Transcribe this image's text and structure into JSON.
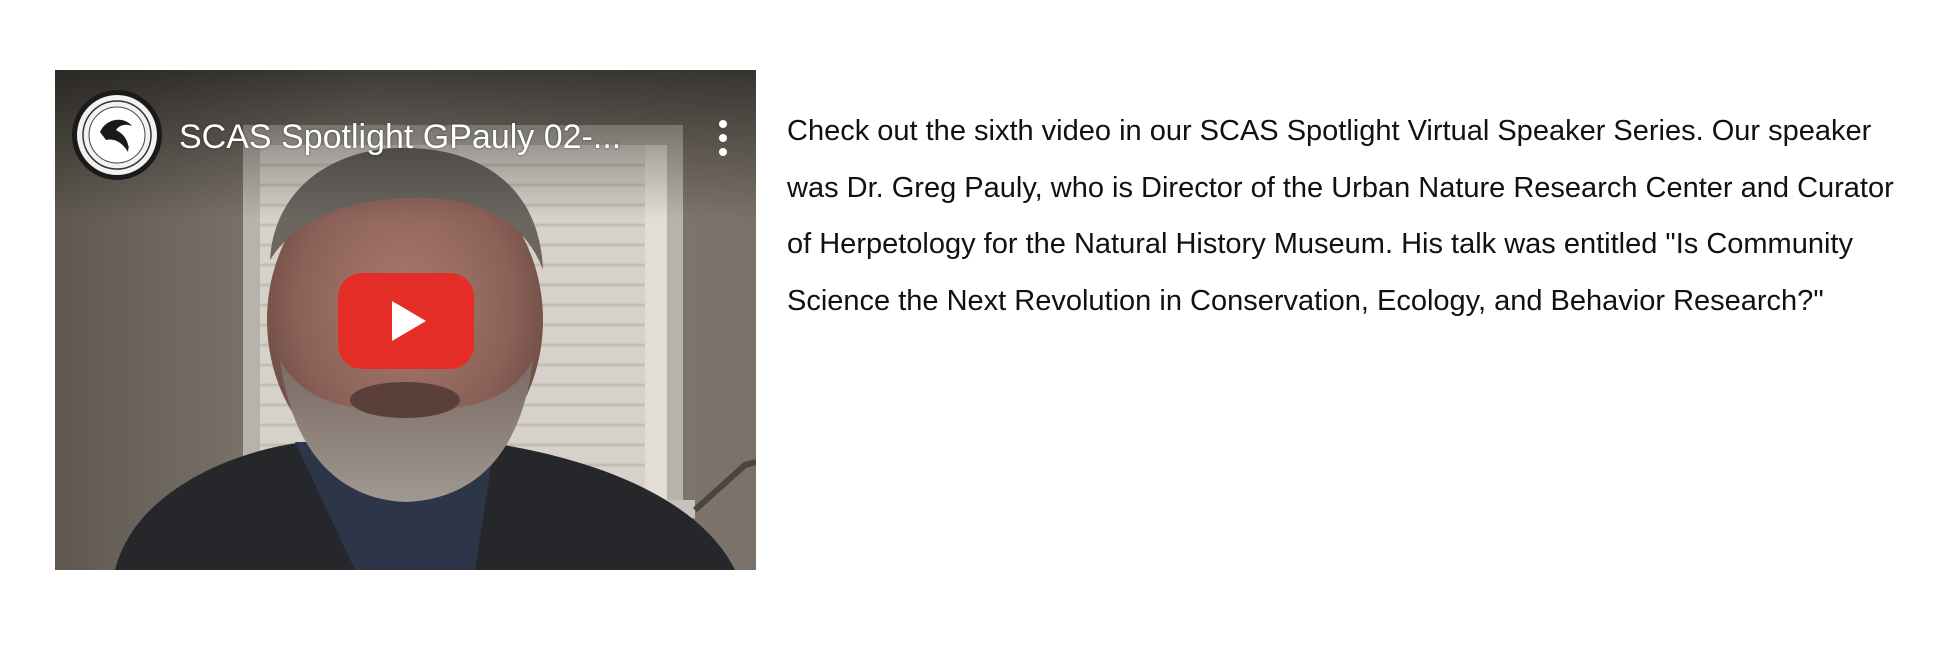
{
  "video": {
    "title": "SCAS Spotlight GPauly 02-...",
    "channel_avatar_icon": "scas-logo-icon",
    "more_icon": "more-vertical-icon",
    "play_icon": "youtube-play-icon",
    "play_button_color": "#e52d27"
  },
  "description": {
    "text": "Check out the sixth video in our SCAS Spotlight Virtual Speaker Series. Our speaker was Dr. Greg Pauly, who is Director of the Urban Nature Research Center and Curator of Herpetology for the Natural History Museum. His talk was entitled \"Is Community Science the Next Revolution in Conservation, Ecology, and Behavior Research?\""
  }
}
